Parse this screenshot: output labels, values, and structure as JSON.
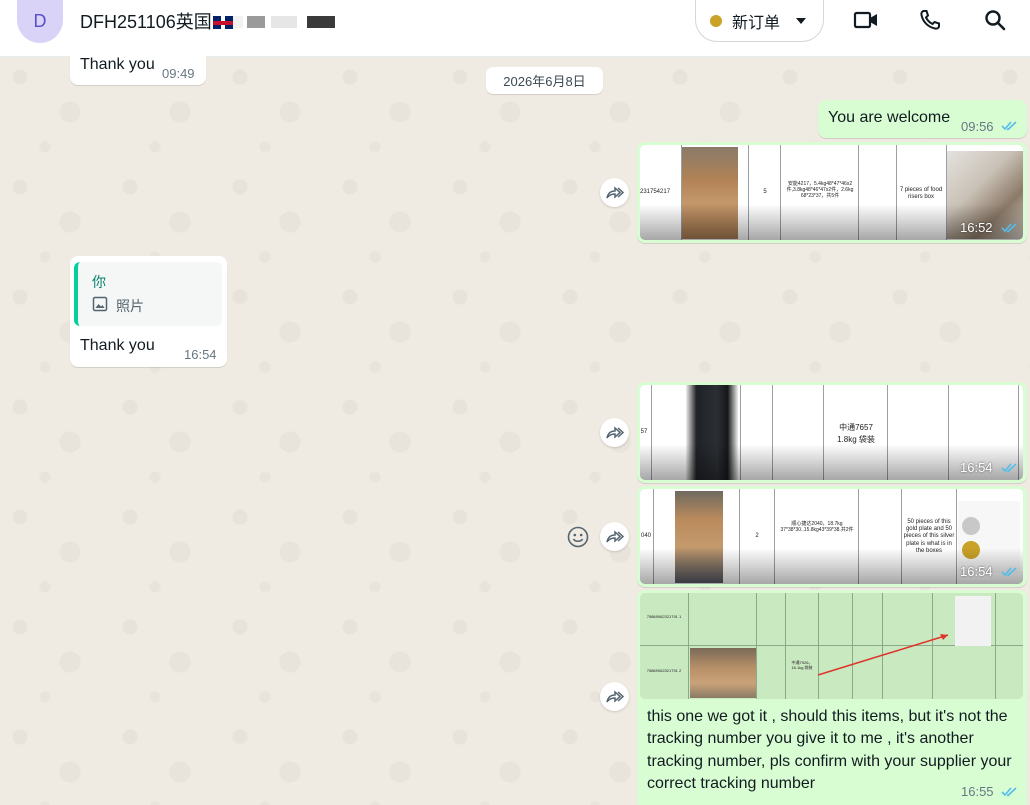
{
  "header": {
    "avatar_letter": "D",
    "chat_title": "DFH251106英国",
    "title_suffix": "🇬🇧 Ba",
    "order_button": "新订单",
    "order_status_color": "#c9a227",
    "icons": [
      "video-call-icon",
      "voice-call-icon",
      "search-icon"
    ]
  },
  "messages": {
    "prev_in": {
      "text": "Thank you",
      "time": "09:49"
    },
    "date_separator": "2026年6月8日",
    "out_welcome": {
      "text": "You are welcome",
      "time": "09:56"
    },
    "out_image1": {
      "time": "16:52",
      "cells": [
        "231754217",
        "5",
        "安能4217，5.4kg48*47*46x2件,3.8kg48*46*47x2件，2.6kg 68*23*37，共5件",
        "7 pieces of food risers box"
      ]
    },
    "in_reply": {
      "quoted_author": "你",
      "quoted_kind": "照片",
      "text": "Thank you",
      "time": "16:54"
    },
    "out_image2": {
      "time": "16:54",
      "cells": [
        "57",
        "中通7657",
        "1.8kg 袋装"
      ]
    },
    "out_image3": {
      "time": "16:54",
      "cells": [
        "040",
        "2",
        "顺心捷达2040，18.7kg 37*38*30..15.8kg43*39*38.共2件",
        "50 pieces of this gold plate and 50 pieces of this silver plate is what is in the boxes"
      ]
    },
    "out_image4": {
      "cells": [
        "75869062321791 1",
        "75869062321791 2",
        "中通7926，16.1kg 袋装"
      ]
    },
    "out_long": {
      "text": "this one we got it , should this items, but it's not the tracking number you give it to me , it's another tracking number, pls confirm with your supplier your correct tracking number",
      "time": "16:55"
    }
  },
  "colors": {
    "outgoing_bubble": "#d9fdd3",
    "incoming_bubble": "#ffffff",
    "read_ticks": "#53bdeb",
    "wallpaper": "#efeae2",
    "reply_accent": "#06cf9c"
  }
}
